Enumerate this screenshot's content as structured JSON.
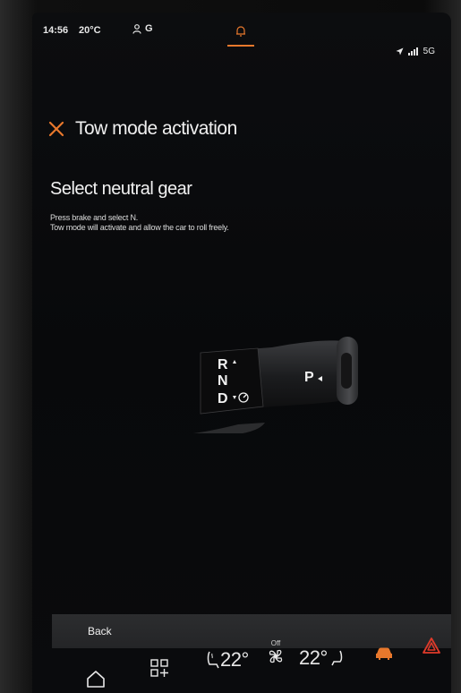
{
  "status_bar": {
    "time": "14:56",
    "temperature": "20°C",
    "profile": "G",
    "network": "5G"
  },
  "header": {
    "title": "Tow mode activation"
  },
  "content": {
    "heading": "Select neutral gear",
    "description_line1": "Press brake and select N.",
    "description_line2": "Tow mode will activate and allow the car to roll freely."
  },
  "gear_selector": {
    "r": "R",
    "n": "N",
    "d": "D",
    "p": "P"
  },
  "back_bar": {
    "label": "Back"
  },
  "climate": {
    "driver_temp": "22°",
    "fan_status": "Off",
    "passenger_temp": "22°"
  },
  "colors": {
    "accent": "#e8782c",
    "hazard": "#e03a2a",
    "car_icon": "#e8782c"
  },
  "icons": [
    "close-icon",
    "person-icon",
    "bell-icon",
    "location-arrow-icon",
    "signal-icon",
    "home-icon",
    "apps-icon",
    "seat-heat-icon",
    "fan-icon",
    "car-icon",
    "hazard-icon"
  ]
}
